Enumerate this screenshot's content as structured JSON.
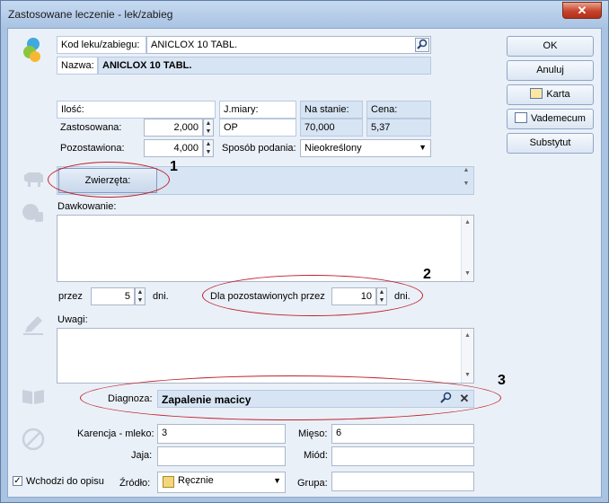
{
  "window": {
    "title": "Zastosowane leczenie - lek/zabieg",
    "close_label": "✕"
  },
  "drug": {
    "code_label": "Kod leku/zabiegu:",
    "code_value": "ANICLOX  10 TABL.",
    "name_label": "Nazwa:",
    "name_value": "ANICLOX  10 TABL."
  },
  "quantity": {
    "header_label": "Ilość:",
    "applied_label": "Zastosowana:",
    "applied_value": "2,000",
    "remaining_label": "Pozostawiona:",
    "remaining_value": "4,000",
    "unit_header": "J.miary:",
    "unit_value": "OP",
    "stock_header": "Na stanie:",
    "stock_value": "70,000",
    "price_header": "Cena:",
    "price_value": "5,37",
    "admin_label": "Sposób podania:",
    "admin_value": "Nieokreślony"
  },
  "animals": {
    "button_label": "Zwierzęta:"
  },
  "dosage": {
    "label": "Dawkowanie:",
    "for_label": "przez",
    "for_value": "5",
    "days_label": "dni.",
    "remaining_for_label": "Dla pozostawionych przez",
    "remaining_for_value": "10",
    "remaining_days_label": "dni."
  },
  "notes": {
    "label": "Uwagi:"
  },
  "diagnosis": {
    "label": "Diagnoza:",
    "value": "Zapalenie macicy"
  },
  "withdrawal": {
    "milk_label": "Karencja - mleko:",
    "milk_value": "3",
    "meat_label": "Mięso:",
    "meat_value": "6",
    "eggs_label": "Jaja:",
    "eggs_value": "",
    "honey_label": "Miód:",
    "honey_value": ""
  },
  "footer": {
    "include_label": "Wchodzi do opisu",
    "include_checked": true,
    "source_label": "Źródło:",
    "source_value": "Ręcznie",
    "group_label": "Grupa:",
    "group_value": ""
  },
  "side_buttons": {
    "ok": "OK",
    "cancel": "Anuluj",
    "card": "Karta",
    "vademecum": "Vademecum",
    "substitute": "Substytut"
  },
  "annotations": {
    "m1": "1",
    "m2": "2",
    "m3": "3"
  }
}
